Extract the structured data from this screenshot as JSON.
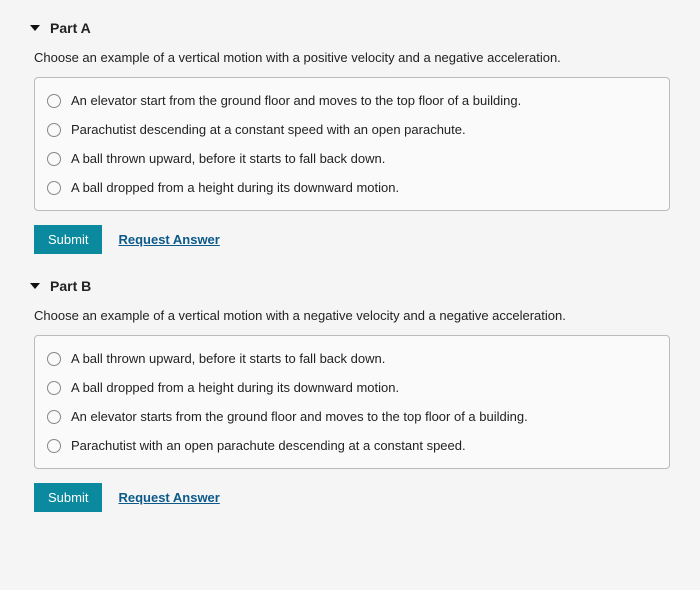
{
  "partA": {
    "title": "Part A",
    "prompt": "Choose an example of a vertical motion with a positive velocity and a negative acceleration.",
    "options": [
      "An elevator start from the ground floor and moves to the top floor of a building.",
      "Parachutist descending at a constant speed with an open parachute.",
      "A ball thrown upward, before it starts to fall back down.",
      "A ball dropped from a height during its downward motion."
    ],
    "submit_label": "Submit",
    "request_label": "Request Answer"
  },
  "partB": {
    "title": "Part B",
    "prompt": "Choose an example of a vertical motion with a negative velocity and a negative acceleration.",
    "options": [
      "A ball thrown upward, before it starts to fall back down.",
      "A ball dropped from a height during its downward motion.",
      "An elevator starts from the ground floor and moves to the top floor of a building.",
      "Parachutist with an open parachute descending at a constant speed."
    ],
    "submit_label": "Submit",
    "request_label": "Request Answer"
  }
}
